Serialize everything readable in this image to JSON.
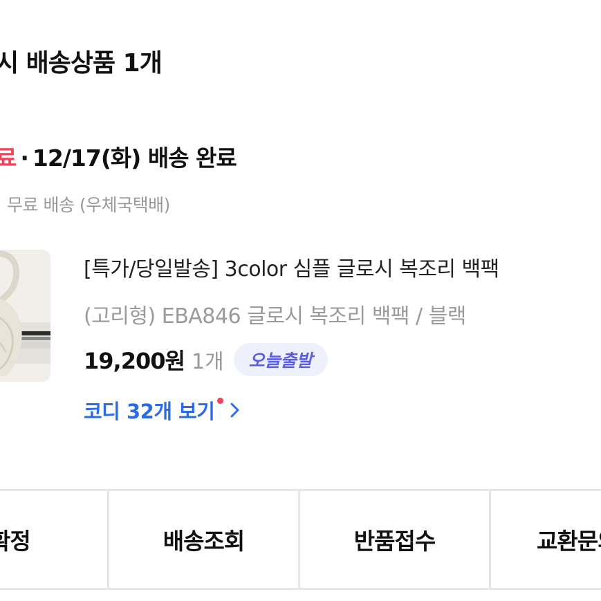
{
  "header": {
    "title": "시 배송상품 1개"
  },
  "delivery": {
    "status_prefix": "료",
    "separator": "·",
    "status_text": "12/17(화) 배송 완료",
    "status_color": "#f0425b",
    "shipping_info": "무료 배송 (우체국택배)"
  },
  "product": {
    "image_icon": "product-thumbnail",
    "name": "[특가/당일발송] 3color 심플 글로시 복조리 백팩",
    "option": "(고리형) EBA846 글로시 복조리 백팩 / 블랙",
    "price": "19,200원",
    "quantity": "1개",
    "badge": "오늘출발"
  },
  "coordi": {
    "label": "코디 32개 보기",
    "icon": "chevron-right-icon",
    "accent_color": "#2c6be8"
  },
  "actions": [
    {
      "label": "구매확정"
    },
    {
      "label": "배송조회"
    },
    {
      "label": "반품접수"
    },
    {
      "label": "교환문의"
    }
  ]
}
